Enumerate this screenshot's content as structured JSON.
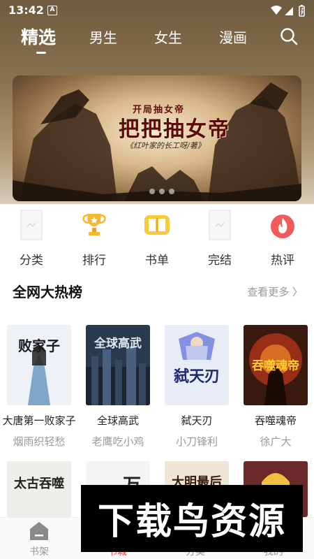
{
  "status_bar": {
    "time": "13:42",
    "notification_badge": "A"
  },
  "nav": {
    "tabs": [
      {
        "label": "精选",
        "active": true
      },
      {
        "label": "男生",
        "active": false
      },
      {
        "label": "女生",
        "active": false
      },
      {
        "label": "漫画",
        "active": false
      }
    ],
    "search_icon": "search-icon"
  },
  "banner": {
    "subtitle": "开局抽女帝",
    "title": "把把抽女帝",
    "author_line": "《红叶家的长工呀/著》",
    "dots": 3
  },
  "categories": [
    {
      "label": "分类",
      "icon": "placeholder-icon"
    },
    {
      "label": "排行",
      "icon": "trophy-icon"
    },
    {
      "label": "书单",
      "icon": "book-list-icon"
    },
    {
      "label": "完结",
      "icon": "placeholder-icon"
    },
    {
      "label": "热评",
      "icon": "flame-icon"
    }
  ],
  "hot_list": {
    "title": "全网大热榜",
    "more": "查看更多 〉",
    "books": [
      {
        "title": "大唐第一败家子",
        "author": "烟雨织轻愁",
        "cover_text": "败家子",
        "cover_bg": "#eef2f6",
        "cover_color": "#1a1a1a"
      },
      {
        "title": "全球高武",
        "author": "老鹰吃小鸡",
        "cover_text": "全球高武",
        "cover_bg": "#2a3a4e",
        "cover_color": "#dfe8f2"
      },
      {
        "title": "弑天刃",
        "author": "小刀锋利",
        "cover_text": "弑天刃",
        "cover_bg": "#e8ecf7",
        "cover_color": "#1c2a6e"
      },
      {
        "title": "吞噬魂帝",
        "author": "徐广大",
        "cover_text": "吞噬魂帝",
        "cover_bg": "#3a1a10",
        "cover_color": "#ffcc33"
      }
    ],
    "row2_covers": [
      {
        "cover_text": "太古吞噬",
        "cover_bg": "#f0eee8",
        "cover_color": "#222"
      },
      {
        "cover_text": "万",
        "cover_bg": "#f4f4f4",
        "cover_color": "#222"
      },
      {
        "cover_text": "大明最后",
        "cover_bg": "#efe6d6",
        "cover_color": "#3a1a0a"
      },
      {
        "cover_text": "",
        "cover_bg": "#6a2a2a",
        "cover_color": "#fff"
      }
    ]
  },
  "tabbar": {
    "tabs": [
      {
        "label": "书架",
        "active": false
      },
      {
        "label": "书城",
        "active": true
      },
      {
        "label": "分类",
        "active": false
      },
      {
        "label": "我的",
        "active": false
      }
    ]
  },
  "watermark": {
    "text": "下载鸟资源"
  },
  "colors": {
    "accent": "#e8453c",
    "header": "#8a7250"
  }
}
